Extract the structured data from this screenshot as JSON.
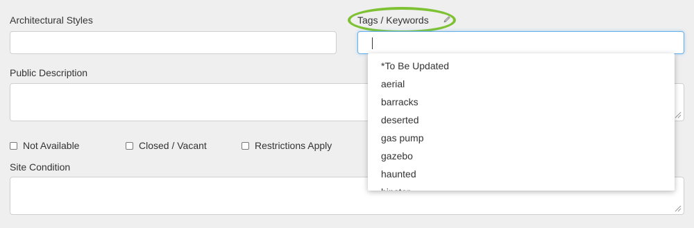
{
  "form": {
    "architectural_styles": {
      "label": "Architectural Styles",
      "value": ""
    },
    "tags_keywords": {
      "label": "Tags / Keywords",
      "value": ""
    },
    "public_description": {
      "label": "Public Description",
      "value": ""
    },
    "site_condition": {
      "label": "Site Condition",
      "value": ""
    },
    "checkboxes": [
      {
        "label": "Not Available",
        "checked": false
      },
      {
        "label": "Closed / Vacant",
        "checked": false
      },
      {
        "label": "Restrictions Apply",
        "checked": false
      }
    ]
  },
  "tags_dropdown": {
    "options": [
      "*To Be Updated",
      "aerial",
      "barracks",
      "deserted",
      "gas pump",
      "gazebo",
      "haunted",
      "hipster"
    ]
  },
  "colors": {
    "highlight_ring": "#7ec233",
    "focus_border": "#66afe9",
    "page_background": "#efefef"
  },
  "icons": {
    "tags_edit": "pencil-icon",
    "textarea_resize": "resize-grip-icon"
  }
}
